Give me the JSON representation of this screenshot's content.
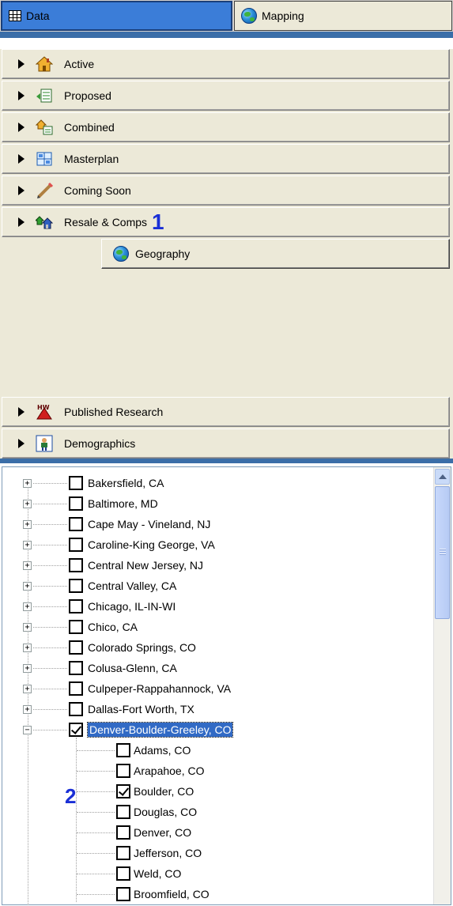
{
  "tabs": {
    "data_label": "Data",
    "mapping_label": "Mapping"
  },
  "accordion": {
    "items": [
      {
        "label": "Active",
        "icon": "house-icon"
      },
      {
        "label": "Proposed",
        "icon": "proposed-icon"
      },
      {
        "label": "Combined",
        "icon": "combined-icon"
      },
      {
        "label": "Masterplan",
        "icon": "masterplan-icon"
      },
      {
        "label": "Coming Soon",
        "icon": "pencil-icon"
      },
      {
        "label": "Resale & Comps",
        "icon": "resale-icon"
      },
      {
        "label": "Published Research",
        "icon": "research-icon"
      },
      {
        "label": "Demographics",
        "icon": "person-icon"
      }
    ],
    "callout_1": "1",
    "geography_label": "Geography"
  },
  "tree": {
    "markets": [
      {
        "label": "Bakersfield, CA",
        "checked": false
      },
      {
        "label": "Baltimore, MD",
        "checked": false
      },
      {
        "label": "Cape May - Vineland, NJ",
        "checked": false
      },
      {
        "label": "Caroline-King George, VA",
        "checked": false
      },
      {
        "label": "Central New Jersey, NJ",
        "checked": false
      },
      {
        "label": "Central Valley, CA",
        "checked": false
      },
      {
        "label": "Chicago, IL-IN-WI",
        "checked": false
      },
      {
        "label": "Chico, CA",
        "checked": false
      },
      {
        "label": "Colorado Springs, CO",
        "checked": false
      },
      {
        "label": "Colusa-Glenn, CA",
        "checked": false
      },
      {
        "label": "Culpeper-Rappahannock, VA",
        "checked": false
      },
      {
        "label": "Dallas-Fort Worth, TX",
        "checked": false
      },
      {
        "label": "Denver-Boulder-Greeley, CO",
        "checked": true,
        "selected": true,
        "expanded": true
      }
    ],
    "counties": [
      {
        "label": "Adams, CO",
        "checked": false
      },
      {
        "label": "Arapahoe, CO",
        "checked": false
      },
      {
        "label": "Boulder, CO",
        "checked": true
      },
      {
        "label": "Douglas, CO",
        "checked": false
      },
      {
        "label": "Denver, CO",
        "checked": false
      },
      {
        "label": "Jefferson, CO",
        "checked": false
      },
      {
        "label": "Weld, CO",
        "checked": false
      },
      {
        "label": "Broomfield, CO",
        "checked": false
      }
    ],
    "callout_2": "2"
  }
}
